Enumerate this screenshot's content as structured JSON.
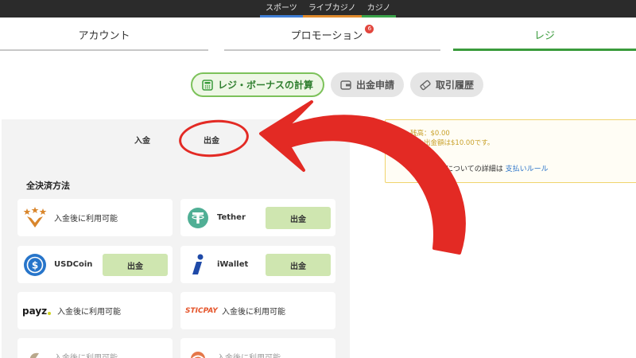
{
  "topnav": [
    {
      "label": "スポーツ",
      "color": "#3f7ed6"
    },
    {
      "label": "ライブカジノ",
      "color": "#e08a2c"
    },
    {
      "label": "カジノ",
      "color": "#3aa34a"
    }
  ],
  "tabs": {
    "account": "アカウント",
    "promotion": "プロモーション",
    "promotion_badge": "6",
    "cashier": "レジ"
  },
  "pills": {
    "calc": "レジ・ボーナスの計算",
    "withdraw_request": "出金申請",
    "history": "取引履歴"
  },
  "subtabs": {
    "deposit": "入金",
    "withdraw": "出金"
  },
  "section_title": "全決済方法",
  "methods": [
    {
      "icon": "stars-icon",
      "text": "入金後に利用可能"
    },
    {
      "icon": "tether-icon",
      "name": "Tether",
      "button": "出金"
    },
    {
      "icon": "usdcoin-icon",
      "name": "USDCoin",
      "button": "出金"
    },
    {
      "icon": "iwallet-icon",
      "name": "iWallet",
      "button": "出金"
    },
    {
      "logo_text": "payz",
      "text": "入金後に利用可能"
    },
    {
      "logo_text": "STICPAY",
      "text": "入金後に利用可能"
    },
    {
      "text": "入金後に利用可能"
    },
    {
      "text": "入金後に利用可能"
    }
  ],
  "info": {
    "balance": "残高：$0.00",
    "min_withdraw": "最小出金額は$10.00です。",
    "rule_text": "出金ルールについての詳細は",
    "rule_link": "支払いルール"
  },
  "colors": {
    "accent_green": "#3a9b3c",
    "button_green": "#cfe6b0",
    "annotation_red": "#e32a24",
    "warning_yellow": "#e8b525"
  }
}
